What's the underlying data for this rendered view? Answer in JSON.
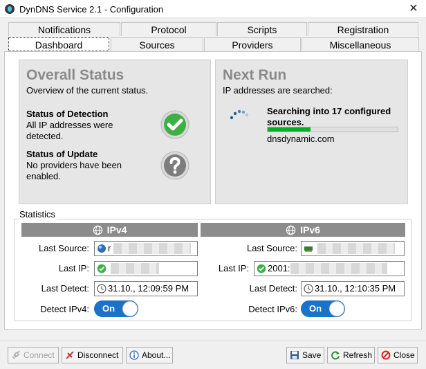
{
  "window": {
    "title": "DynDNS Service 2.1 - Configuration",
    "close_glyph": "✕"
  },
  "tabs": {
    "row1": [
      "Notifications",
      "Protocol",
      "Scripts",
      "Registration"
    ],
    "row2": [
      "Dashboard",
      "Sources",
      "Providers",
      "Miscellaneous"
    ],
    "active": "Dashboard"
  },
  "overall_status": {
    "title": "Overall Status",
    "subtitle": "Overview of the current status.",
    "detection_title": "Status of Detection",
    "detection_line1": "All IP addresses were",
    "detection_line2": "detected.",
    "detection_icon": "check-circle-icon",
    "update_title": "Status of Update",
    "update_line1": "No providers have been",
    "update_line2": "enabled.",
    "update_icon": "question-circle-icon"
  },
  "next_run": {
    "title": "Next Run",
    "subtitle": "IP addresses are searched:",
    "searching_line1": "Searching into 17 configured",
    "searching_line2": "sources.",
    "progress": 0.33,
    "current_source": "dnsdynamic.com",
    "spinner_icon": "loading-spinner-icon"
  },
  "statistics": {
    "legend": "Statistics",
    "ipv4": {
      "header": "IPv4",
      "last_source_label": "Last Source:",
      "last_source_value": "r",
      "last_ip_label": "Last IP:",
      "last_ip_value": "",
      "last_detect_label": "Last Detect:",
      "last_detect_value": "31.10., 12:09:59 PM",
      "detect_label": "Detect IPv4:",
      "toggle": "On"
    },
    "ipv6": {
      "header": "IPv6",
      "last_source_label": "Last Source:",
      "last_source_value": "",
      "last_ip_label": "Last IP:",
      "last_ip_value": "2001:",
      "last_detect_label": "Last Detect:",
      "last_detect_value": "31.10., 12:10:35 PM",
      "detect_label": "Detect IPv6:",
      "toggle": "On"
    }
  },
  "buttons": {
    "connect": "Connect",
    "disconnect": "Disconnect",
    "about": "About...",
    "save": "Save",
    "refresh": "Refresh",
    "close": "Close"
  },
  "colors": {
    "accent_blue": "#1a73c9",
    "progress_green": "#06b025",
    "check_green": "#3cb043",
    "header_gray": "#8c8c8c"
  }
}
